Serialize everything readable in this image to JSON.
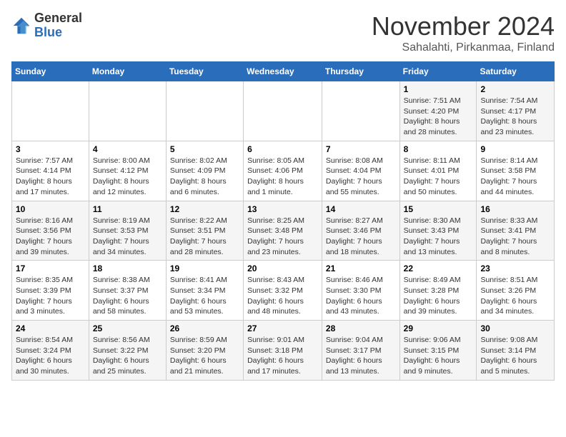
{
  "logo": {
    "general": "General",
    "blue": "Blue"
  },
  "header": {
    "month": "November 2024",
    "location": "Sahalahti, Pirkanmaa, Finland"
  },
  "weekdays": [
    "Sunday",
    "Monday",
    "Tuesday",
    "Wednesday",
    "Thursday",
    "Friday",
    "Saturday"
  ],
  "weeks": [
    [
      {
        "day": "",
        "info": ""
      },
      {
        "day": "",
        "info": ""
      },
      {
        "day": "",
        "info": ""
      },
      {
        "day": "",
        "info": ""
      },
      {
        "day": "",
        "info": ""
      },
      {
        "day": "1",
        "info": "Sunrise: 7:51 AM\nSunset: 4:20 PM\nDaylight: 8 hours and 28 minutes."
      },
      {
        "day": "2",
        "info": "Sunrise: 7:54 AM\nSunset: 4:17 PM\nDaylight: 8 hours and 23 minutes."
      }
    ],
    [
      {
        "day": "3",
        "info": "Sunrise: 7:57 AM\nSunset: 4:14 PM\nDaylight: 8 hours and 17 minutes."
      },
      {
        "day": "4",
        "info": "Sunrise: 8:00 AM\nSunset: 4:12 PM\nDaylight: 8 hours and 12 minutes."
      },
      {
        "day": "5",
        "info": "Sunrise: 8:02 AM\nSunset: 4:09 PM\nDaylight: 8 hours and 6 minutes."
      },
      {
        "day": "6",
        "info": "Sunrise: 8:05 AM\nSunset: 4:06 PM\nDaylight: 8 hours and 1 minute."
      },
      {
        "day": "7",
        "info": "Sunrise: 8:08 AM\nSunset: 4:04 PM\nDaylight: 7 hours and 55 minutes."
      },
      {
        "day": "8",
        "info": "Sunrise: 8:11 AM\nSunset: 4:01 PM\nDaylight: 7 hours and 50 minutes."
      },
      {
        "day": "9",
        "info": "Sunrise: 8:14 AM\nSunset: 3:58 PM\nDaylight: 7 hours and 44 minutes."
      }
    ],
    [
      {
        "day": "10",
        "info": "Sunrise: 8:16 AM\nSunset: 3:56 PM\nDaylight: 7 hours and 39 minutes."
      },
      {
        "day": "11",
        "info": "Sunrise: 8:19 AM\nSunset: 3:53 PM\nDaylight: 7 hours and 34 minutes."
      },
      {
        "day": "12",
        "info": "Sunrise: 8:22 AM\nSunset: 3:51 PM\nDaylight: 7 hours and 28 minutes."
      },
      {
        "day": "13",
        "info": "Sunrise: 8:25 AM\nSunset: 3:48 PM\nDaylight: 7 hours and 23 minutes."
      },
      {
        "day": "14",
        "info": "Sunrise: 8:27 AM\nSunset: 3:46 PM\nDaylight: 7 hours and 18 minutes."
      },
      {
        "day": "15",
        "info": "Sunrise: 8:30 AM\nSunset: 3:43 PM\nDaylight: 7 hours and 13 minutes."
      },
      {
        "day": "16",
        "info": "Sunrise: 8:33 AM\nSunset: 3:41 PM\nDaylight: 7 hours and 8 minutes."
      }
    ],
    [
      {
        "day": "17",
        "info": "Sunrise: 8:35 AM\nSunset: 3:39 PM\nDaylight: 7 hours and 3 minutes."
      },
      {
        "day": "18",
        "info": "Sunrise: 8:38 AM\nSunset: 3:37 PM\nDaylight: 6 hours and 58 minutes."
      },
      {
        "day": "19",
        "info": "Sunrise: 8:41 AM\nSunset: 3:34 PM\nDaylight: 6 hours and 53 minutes."
      },
      {
        "day": "20",
        "info": "Sunrise: 8:43 AM\nSunset: 3:32 PM\nDaylight: 6 hours and 48 minutes."
      },
      {
        "day": "21",
        "info": "Sunrise: 8:46 AM\nSunset: 3:30 PM\nDaylight: 6 hours and 43 minutes."
      },
      {
        "day": "22",
        "info": "Sunrise: 8:49 AM\nSunset: 3:28 PM\nDaylight: 6 hours and 39 minutes."
      },
      {
        "day": "23",
        "info": "Sunrise: 8:51 AM\nSunset: 3:26 PM\nDaylight: 6 hours and 34 minutes."
      }
    ],
    [
      {
        "day": "24",
        "info": "Sunrise: 8:54 AM\nSunset: 3:24 PM\nDaylight: 6 hours and 30 minutes."
      },
      {
        "day": "25",
        "info": "Sunrise: 8:56 AM\nSunset: 3:22 PM\nDaylight: 6 hours and 25 minutes."
      },
      {
        "day": "26",
        "info": "Sunrise: 8:59 AM\nSunset: 3:20 PM\nDaylight: 6 hours and 21 minutes."
      },
      {
        "day": "27",
        "info": "Sunrise: 9:01 AM\nSunset: 3:18 PM\nDaylight: 6 hours and 17 minutes."
      },
      {
        "day": "28",
        "info": "Sunrise: 9:04 AM\nSunset: 3:17 PM\nDaylight: 6 hours and 13 minutes."
      },
      {
        "day": "29",
        "info": "Sunrise: 9:06 AM\nSunset: 3:15 PM\nDaylight: 6 hours and 9 minutes."
      },
      {
        "day": "30",
        "info": "Sunrise: 9:08 AM\nSunset: 3:14 PM\nDaylight: 6 hours and 5 minutes."
      }
    ]
  ]
}
